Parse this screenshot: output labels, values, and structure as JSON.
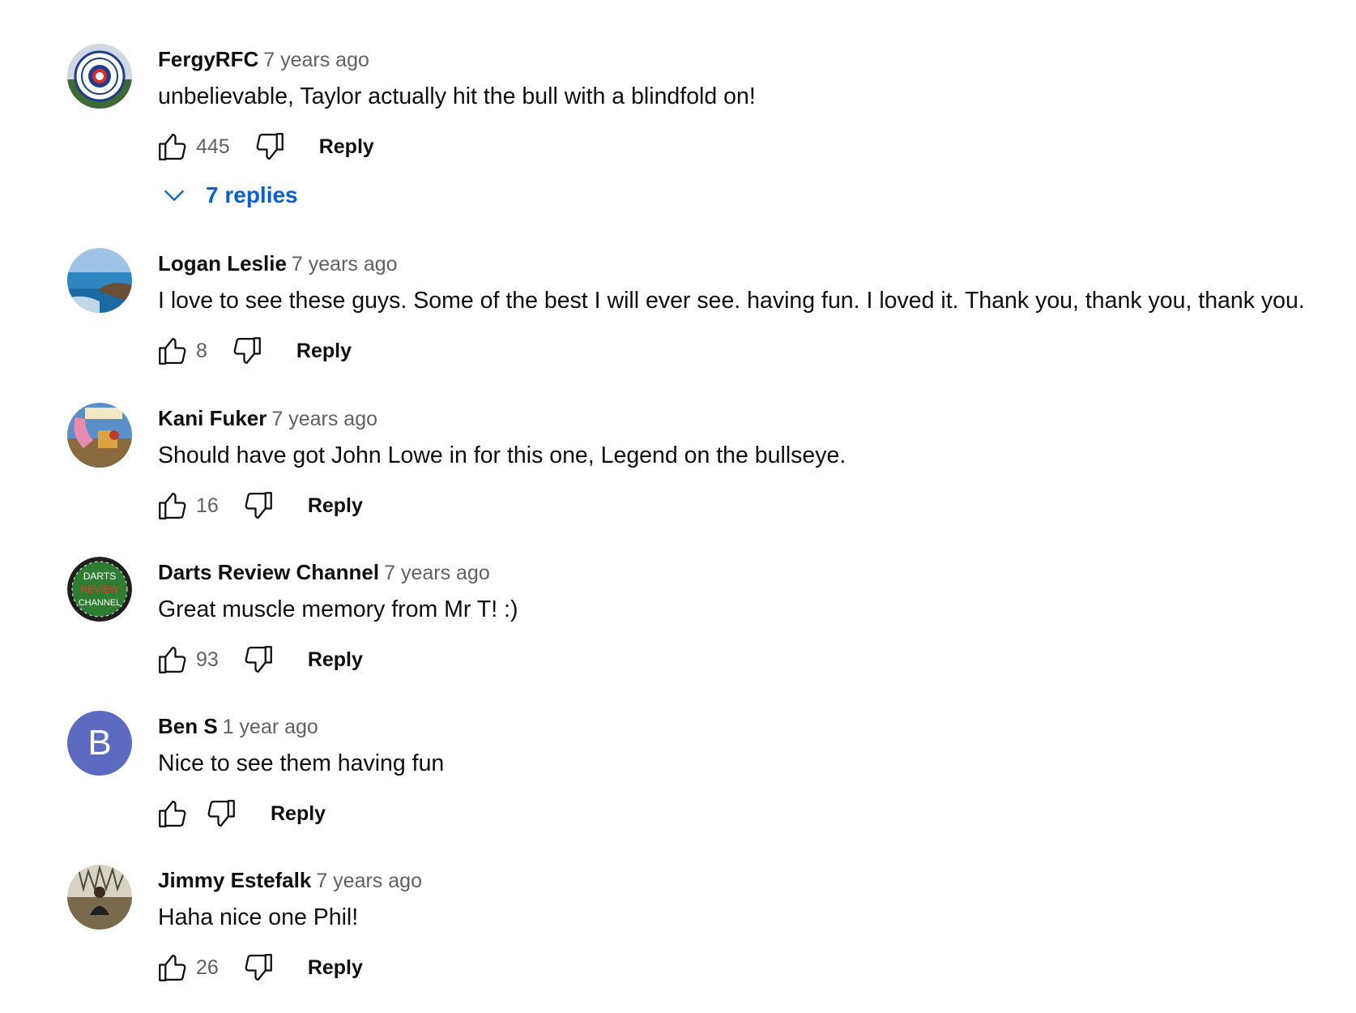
{
  "comments": [
    {
      "author": "FergyRFC",
      "time": "7 years ago",
      "text": "unbelievable, Taylor actually hit the bull with a blindfold on!",
      "likes": "445",
      "reply_label": "Reply",
      "replies_label": "7 replies"
    },
    {
      "author": "Logan Leslie",
      "time": "7 years ago",
      "text": "I love to see these guys. Some of the best I will ever see. having fun. I loved it. Thank you, thank you, thank you.",
      "likes": "8",
      "reply_label": "Reply"
    },
    {
      "author": "Kani Fuker",
      "time": "7 years ago",
      "text": "Should have got John Lowe in for this one, Legend on the bullseye.",
      "likes": "16",
      "reply_label": "Reply"
    },
    {
      "author": "Darts Review Channel",
      "time": "7 years ago",
      "text": "Great muscle memory from Mr T! :)",
      "likes": "93",
      "reply_label": "Reply",
      "avatar_text": [
        "DARTS",
        "REVIEW",
        "CHANNEL"
      ]
    },
    {
      "author": "Ben S",
      "time": "1 year ago",
      "text": "Nice to see them having fun",
      "likes": "",
      "reply_label": "Reply",
      "avatar_letter": "B"
    },
    {
      "author": "Jimmy Estefalk",
      "time": "7 years ago",
      "text": "Haha nice one Phil!",
      "likes": "26",
      "reply_label": "Reply"
    }
  ],
  "colors": {
    "link_blue": "#065fd4",
    "secondary_text": "#606060",
    "letter_avatar_bg": "#5c6bc0"
  },
  "icons": {
    "like": "thumbs-up-icon",
    "dislike": "thumbs-down-icon",
    "expand": "chevron-down-icon"
  }
}
